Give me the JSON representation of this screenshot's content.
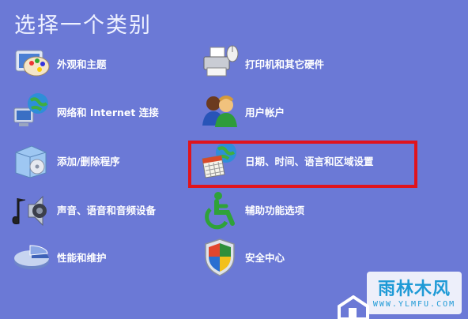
{
  "title": "选择一个类别",
  "categories": {
    "appearance": {
      "label": "外观和主题",
      "icon": "appearance-themes-icon"
    },
    "printers": {
      "label": "打印机和其它硬件",
      "icon": "printer-mouse-icon"
    },
    "network": {
      "label": "网络和 Internet 连接",
      "icon": "network-globe-icon"
    },
    "users": {
      "label": "用户帐户",
      "icon": "user-accounts-icon"
    },
    "addremove": {
      "label": "添加/删除程序",
      "icon": "add-remove-programs-icon"
    },
    "datetime": {
      "label": "日期、时间、语言和区域设置",
      "icon": "calendar-globe-icon"
    },
    "sound": {
      "label": "声音、语音和音频设备",
      "icon": "speaker-note-icon"
    },
    "accessibility": {
      "label": "辅助功能选项",
      "icon": "accessibility-icon"
    },
    "performance": {
      "label": "性能和维护",
      "icon": "pie-chart-icon"
    },
    "security": {
      "label": "安全中心",
      "icon": "shield-icon"
    }
  },
  "watermark": {
    "logo": "雨林木风",
    "url": "WWW.YLMFU.COM"
  },
  "colors": {
    "background": "#6b79d6",
    "highlight": "#e0141d"
  }
}
